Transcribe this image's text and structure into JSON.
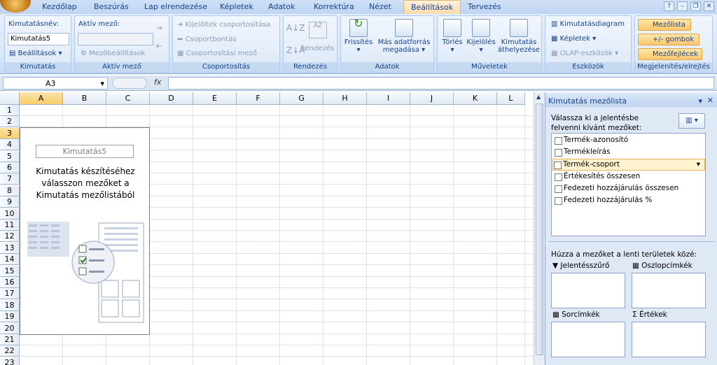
{
  "tabs": [
    "Kezdőlap",
    "Beszúrás",
    "Lap elrendezése",
    "Képletek",
    "Adatok",
    "Korrektúra",
    "Nézet",
    "Beállítások",
    "Tervezés"
  ],
  "active_tab": "Beállítások",
  "ribbon": {
    "kimutatas": {
      "label": "Kimutatásnév:",
      "name_value": "Kimutatás5",
      "options": "Beállítások",
      "group": "Kimutatás"
    },
    "aktiv_mezo": {
      "label": "Aktív mező:",
      "settings": "Mezőbeállítások",
      "group": "Aktív mező"
    },
    "csoport": {
      "sel": "Kijelöltek csoportosítása",
      "ungroup": "Csoportbontás",
      "field": "Csoportosítási mező",
      "group": "Csoportosítás"
    },
    "rendezes": {
      "sort": "Rendezés",
      "group": "Rendezés"
    },
    "adatok": {
      "refresh": "Frissítés",
      "source1": "Más adatforrás",
      "source2": "megadása",
      "group": "Adatok"
    },
    "muveletek": {
      "clear": "Törlés",
      "select": "Kijelölés",
      "move1": "Kimutatás",
      "move2": "áthelyezése",
      "group": "Műveletek"
    },
    "eszkozok": {
      "chart": "Kimutatásdiagram",
      "formulas": "Képletek",
      "olap": "OLAP-eszközök",
      "group": "Eszközök"
    },
    "megjelenites": {
      "fieldlist": "Mezőlista",
      "buttons": "+/- gombok",
      "headers": "Mezőfejlécek",
      "group": "Megjelenítés/elrejtés"
    }
  },
  "formula": {
    "namebox": "A3",
    "fx": "fx"
  },
  "columns": [
    "A",
    "B",
    "C",
    "D",
    "E",
    "F",
    "G",
    "H",
    "I",
    "J",
    "K",
    "L"
  ],
  "rows": [
    "1",
    "2",
    "3",
    "4",
    "5",
    "6",
    "7",
    "8",
    "9",
    "10",
    "11",
    "12",
    "13",
    "14",
    "15",
    "16",
    "17",
    "18",
    "19",
    "20",
    "21",
    "22",
    "23"
  ],
  "pivot": {
    "name": "Kimutatás5",
    "message": "Kimutatás készítéséhez válasszon mezőket a Kimutatás mezőlistából"
  },
  "panel": {
    "title": "Kimutatás mezőlista",
    "instruction": "Válassza ki a jelentésbe felvenni kívánt mezőket:",
    "fields": [
      "Termék-azonosító",
      "Termékleírás",
      "Termék-csoport",
      "Értékesítés összesen",
      "Fedezeti hozzájárulás összesen",
      "Fedezeti hozzájárulás %"
    ],
    "drag_text": "Húzza a mezőket a lenti területek közé:",
    "areas": {
      "filter": "Jelentésszűrő",
      "columns": "Oszlopcímkék",
      "rows": "Sorcímkék",
      "values": "Értékek"
    }
  }
}
